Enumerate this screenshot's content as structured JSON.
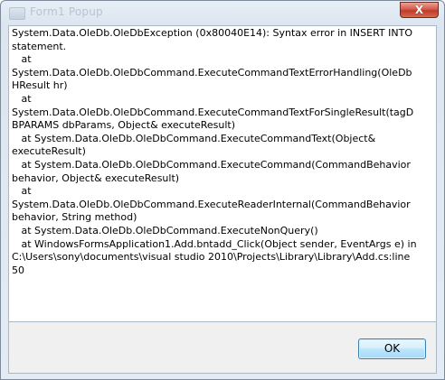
{
  "window": {
    "title": "Form1 Popup"
  },
  "titlebar": {
    "close_label": "X"
  },
  "message": {
    "text": "System.Data.OleDb.OleDbException (0x80040E14): Syntax error in INSERT INTO\nstatement.\n   at\nSystem.Data.OleDb.OleDbCommand.ExecuteCommandTextErrorHandling(OleDb\nHResult hr)\n   at\nSystem.Data.OleDb.OleDbCommand.ExecuteCommandTextForSingleResult(tagD\nBPARAMS dbParams, Object& executeResult)\n   at System.Data.OleDb.OleDbCommand.ExecuteCommandText(Object&\nexecuteResult)\n   at System.Data.OleDb.OleDbCommand.ExecuteCommand(CommandBehavior\nbehavior, Object& executeResult)\n   at\nSystem.Data.OleDb.OleDbCommand.ExecuteReaderInternal(CommandBehavior\nbehavior, String method)\n   at System.Data.OleDb.OleDbCommand.ExecuteNonQuery()\n   at WindowsFormsApplication1.Add.bntadd_Click(Object sender, EventArgs e) in\nC:\\Users\\sony\\documents\\visual studio 2010\\Projects\\Library\\Library\\Add.cs:line\n50"
  },
  "footer": {
    "ok_label": "OK"
  },
  "colors": {
    "frame": "#dde6f0",
    "close_button": "#c33a28",
    "ok_button": "#bee6fd",
    "footer": "#f0f0f0"
  },
  "icons": {
    "window_icon": "app-window-icon",
    "close_icon": "close-icon"
  }
}
